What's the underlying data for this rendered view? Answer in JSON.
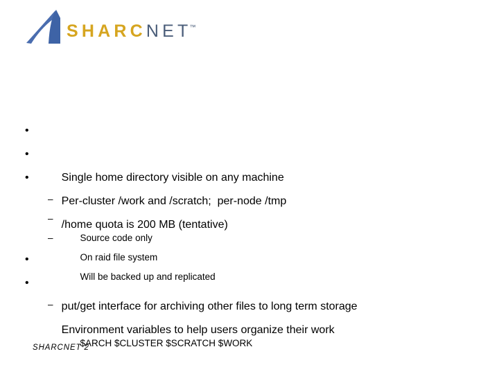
{
  "slide": {
    "logo": {
      "mark_name": "sharcnet-triangle-mark",
      "text_part1": "SHARC",
      "text_part2": "NET",
      "trademark": "™",
      "colors": {
        "mark_blue": "#4A6DAF",
        "gold": "#D6A520",
        "slate": "#4A5D79"
      }
    },
    "bullets": [
      {
        "level": 1,
        "marker": "•",
        "text": "Single home directory visible on any machine"
      },
      {
        "level": 1,
        "marker": "•",
        "text": "Per-cluster /work and /scratch;  per-node /tmp"
      },
      {
        "level": 1,
        "marker": "•",
        "text": "/home quota is 200 MB (tentative)"
      },
      {
        "level": 2,
        "marker": "–",
        "text": "Source code only"
      },
      {
        "level": 2,
        "marker": "–",
        "text": "On raid file system"
      },
      {
        "level": 2,
        "marker": "–",
        "text": "Will be backed up and replicated"
      },
      {
        "level": 1,
        "marker": "•",
        "text": "put/get interface for archiving other files to long term storage"
      },
      {
        "level": 1,
        "marker": "•",
        "text": "Environment variables to help users organize their work"
      },
      {
        "level": 2,
        "marker": "–",
        "text": "$ARCH $CLUSTER $SCRATCH $WORK"
      }
    ],
    "footer": "SHARCNET 2"
  }
}
